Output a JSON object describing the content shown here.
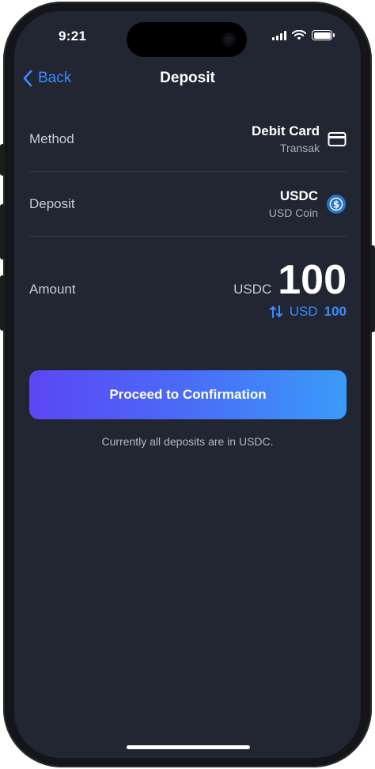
{
  "status_bar": {
    "time": "9:21"
  },
  "nav": {
    "back_label": "Back",
    "title": "Deposit"
  },
  "method": {
    "label": "Method",
    "title": "Debit Card",
    "subtitle": "Transak",
    "icon": "credit-card-icon"
  },
  "deposit": {
    "label": "Deposit",
    "title": "USDC",
    "subtitle": "USD Coin",
    "icon": "usdc-coin-icon",
    "icon_color": "#2775CA"
  },
  "amount": {
    "label": "Amount",
    "unit": "USDC",
    "value": "100",
    "conversion_unit": "USD",
    "conversion_value": "100",
    "conversion_icon": "swap-arrows-icon"
  },
  "cta": {
    "label": "Proceed to Confirmation"
  },
  "note": "Currently all deposits are in USDC.",
  "colors": {
    "accent": "#3A8BFF",
    "background": "#222632",
    "gradient_start": "#5A47F5",
    "gradient_end": "#3A9BF8"
  }
}
